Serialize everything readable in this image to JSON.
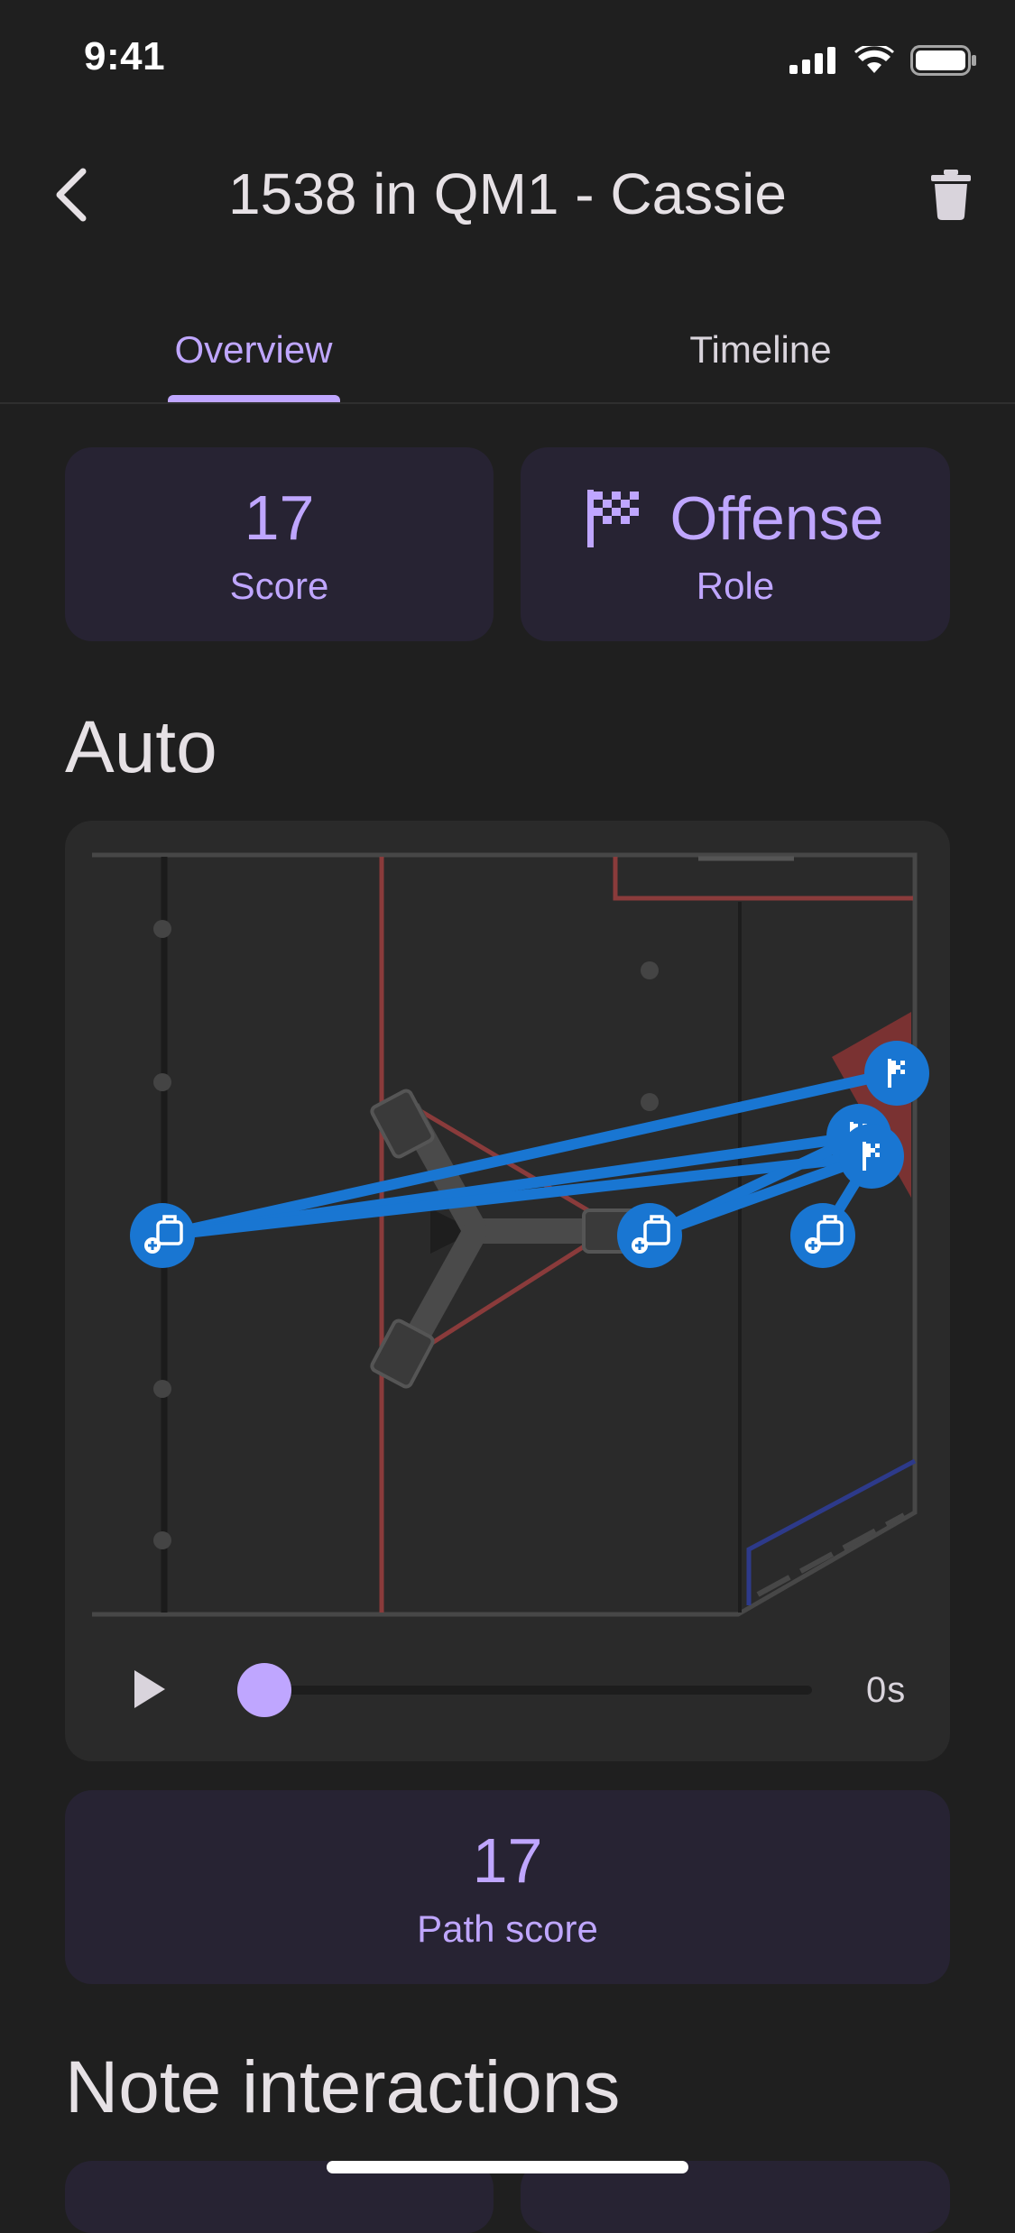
{
  "status_bar": {
    "time": "9:41"
  },
  "app_bar": {
    "title": "1538 in QM1 - Cassie"
  },
  "tabs": [
    {
      "label": "Overview",
      "selected": true
    },
    {
      "label": "Timeline",
      "selected": false
    }
  ],
  "stats": {
    "score": {
      "value": "17",
      "label": "Score"
    },
    "role": {
      "value": "Offense",
      "label": "Role",
      "icon": "checkered-flag-icon"
    }
  },
  "auto": {
    "heading": "Auto",
    "playback": {
      "time": "0s",
      "progress": 0
    },
    "path_score": {
      "value": "17",
      "label": "Path score"
    }
  },
  "notes": {
    "heading": "Note interactions"
  },
  "colors": {
    "accent": "#bfa6ff",
    "card": "#272333",
    "path": "#1976d2",
    "background": "#1f1f1f"
  }
}
